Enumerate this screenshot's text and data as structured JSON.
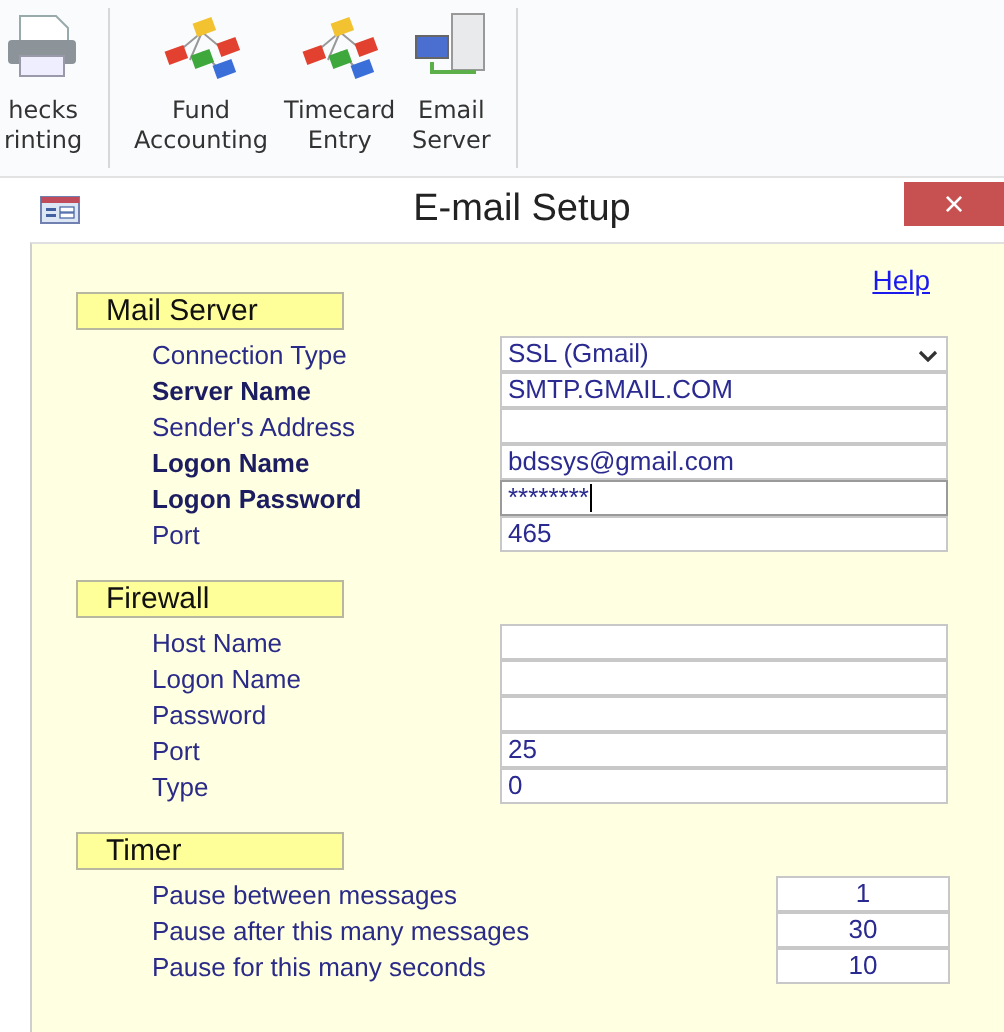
{
  "ribbon": {
    "items": [
      {
        "lines": [
          "hecks",
          "rinting"
        ],
        "kind": "printer"
      },
      {
        "lines": [
          "Fund",
          "Accounting"
        ],
        "kind": "network"
      },
      {
        "lines": [
          "Timecard",
          "Entry"
        ],
        "kind": "network"
      },
      {
        "lines": [
          "Email",
          "Server"
        ],
        "kind": "server"
      }
    ]
  },
  "window": {
    "title": "E-mail Setup",
    "close": "×"
  },
  "help": "Help",
  "sections": [
    {
      "title": "Mail Server",
      "kind": "wide",
      "rows": [
        {
          "label": "Connection Type",
          "value": "SSL (Gmail)",
          "bold": false,
          "dropdown": true,
          "focused": false
        },
        {
          "label": "Server Name",
          "value": "SMTP.GMAIL.COM",
          "bold": true,
          "dropdown": false,
          "focused": false
        },
        {
          "label": "Sender's Address",
          "value": "",
          "bold": false,
          "dropdown": false,
          "focused": false
        },
        {
          "label": "Logon Name",
          "value": "bdssys@gmail.com",
          "bold": true,
          "dropdown": false,
          "focused": false
        },
        {
          "label": "Logon Password",
          "value": "********",
          "bold": true,
          "dropdown": false,
          "focused": true
        },
        {
          "label": "Port",
          "value": "465",
          "bold": false,
          "dropdown": false,
          "focused": false
        }
      ]
    },
    {
      "title": "Firewall",
      "kind": "wide",
      "rows": [
        {
          "label": "Host Name",
          "value": "",
          "bold": false,
          "dropdown": false,
          "focused": false
        },
        {
          "label": "Logon Name",
          "value": "",
          "bold": false,
          "dropdown": false,
          "focused": false
        },
        {
          "label": "Password",
          "value": "",
          "bold": false,
          "dropdown": false,
          "focused": false
        },
        {
          "label": "Port",
          "value": "25",
          "bold": false,
          "dropdown": false,
          "focused": false
        },
        {
          "label": "Type",
          "value": "0",
          "bold": false,
          "dropdown": false,
          "focused": false
        }
      ]
    },
    {
      "title": "Timer",
      "kind": "narrow",
      "rows": [
        {
          "label": "Pause between messages",
          "value": "1",
          "bold": false,
          "dropdown": false,
          "focused": false
        },
        {
          "label": "Pause after this many messages",
          "value": "30",
          "bold": false,
          "dropdown": false,
          "focused": false
        },
        {
          "label": "Pause for this many seconds",
          "value": "10",
          "bold": false,
          "dropdown": false,
          "focused": false
        }
      ]
    }
  ]
}
